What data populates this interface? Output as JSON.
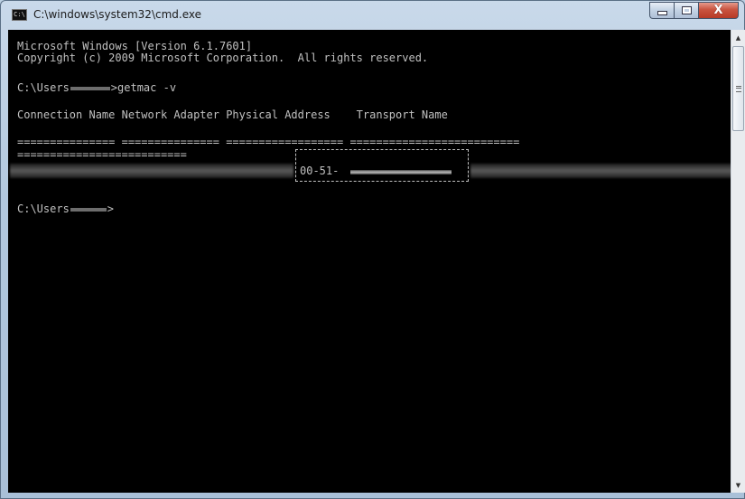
{
  "window": {
    "title": "C:\\windows\\system32\\cmd.exe",
    "app_icon_text": "C:\\",
    "close_glyph": "X"
  },
  "console": {
    "lines": {
      "l1": "Microsoft Windows [Version 6.1.7601]",
      "l2": "Copyright (c) 2009 Microsoft Corporation.  All rights reserved.",
      "l3_prefix": "C:\\Users",
      "l3_command": ">getmac -v",
      "l4_headers": "Connection Name Network Adapter Physical Address    Transport Name",
      "l5_separators": "=============== =============== ================== ==========================",
      "l6_separator_continuation": "==========================",
      "mac_prefix": "00-51-",
      "l8_prefix": "C:\\Users",
      "l8_suffix": ">"
    }
  },
  "colors": {
    "console_background": "#000000",
    "console_text": "#c0c0c0",
    "close_button": "#c9533f"
  }
}
